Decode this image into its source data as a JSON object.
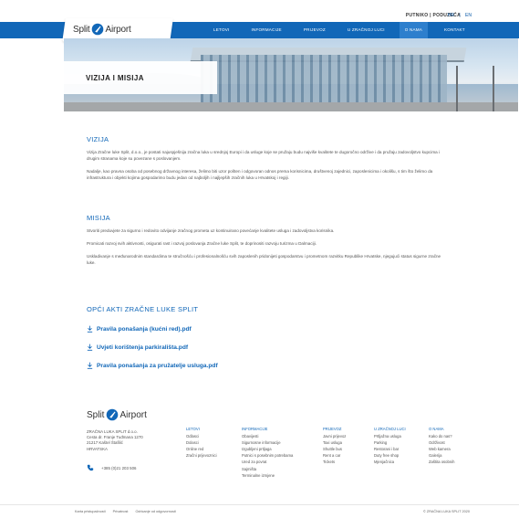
{
  "header": {
    "utility_label": "PUTNIKO | PODUZEĆA",
    "lang": [
      "HR",
      "EN"
    ],
    "logo_left": "Split",
    "logo_right": "Airport"
  },
  "nav": {
    "items": [
      {
        "label": "LETOVI",
        "active": false
      },
      {
        "label": "INFORMACIJE",
        "active": false
      },
      {
        "label": "PRIJEVOZ",
        "active": false
      },
      {
        "label": "U ZRAČNOJ LUCI",
        "active": false
      },
      {
        "label": "O NAMA",
        "active": true
      },
      {
        "label": "KONTAKT",
        "active": false
      }
    ]
  },
  "hero": {
    "title": "VIZIJA I MISIJA"
  },
  "vizija": {
    "heading": "VIZIJA",
    "p1": "Vizija Zračne luke Split, d.o.o., je postati najuspješnija zračna luka u srednjoj Europi i da usluge koje se pružaju budu najviše kvalitete te dugoročno održive i da pružaju zadovoljstvo kupcima i drugim stranama koje su povezane s poslovanjem.",
    "p2": "Nadalje, kao pravna osoba od posebnog državnog interesa, želimo biti uzor pošten i odgovoran odnos prema korisnicima, društvenoj zajednici, zaposlenicima i okolišu, s tim što želimo da infrastruktura i objekti kojima gospodarimo budu jedan od najboljih i najljepših zračnih luka u Hrvatskoj i regiji."
  },
  "misija": {
    "heading": "MISIJA",
    "p1": "Stvoriti preduvjete za sigurno i redovito odvijanje zračnog prometa uz kontinuirano povećanje kvalitete usluga i zadovoljstva korisnika.",
    "p2": "Promicati razvoj svih aktivnosti, osigurati rast i razvoj poslovanja Zračne luke Split, te doprinositi razvoju turizma u Dalmaciji.",
    "p3": "Uskladivanje s međunarodnim standardima te stručnošću i profesionalnošću svih zaposlenih pridonijeti gospodarstvu i prometnom razvitku Republike Hrvatske, njegujući status sigurne zračne luke."
  },
  "akti": {
    "heading": "OPĆI AKTI ZRAČNE LUKE SPLIT",
    "files": [
      "Pravila ponašanja (kućni red).pdf",
      "Uvjeti korištenja parkirališta.pdf",
      "Pravila ponašanja za pružatelje usluga.pdf"
    ]
  },
  "footer": {
    "logo_left": "Split",
    "logo_right": "Airport",
    "address": [
      "ZRAČNA LUKA SPLIT d.o.o.",
      "Cesta dr. Franje Tuđmana 1270",
      "21217 Kaštel Štafilić",
      "HRVATSKA"
    ],
    "phone": "+385 (0)21 203 506",
    "columns": [
      {
        "heading": "LETOVI",
        "items": [
          "Odlasci",
          "Dolasci",
          "Online red",
          "Zračni prijevoznici"
        ]
      },
      {
        "heading": "INFORMACIJE",
        "items": [
          "Obavijesti",
          "Sigurnosne informacije",
          "Izgubljeni prtljaga",
          "Putnici s posebnim potrebama",
          "Ured za povrat",
          "Sajmišta",
          "Terminalne izmjene"
        ]
      },
      {
        "heading": "PRIJEVOZ",
        "items": [
          "Javni prijevoz",
          "Taxi usluga",
          "Shuttle bus",
          "Rent a car",
          "Tickets"
        ]
      },
      {
        "heading": "U ZRAČNOJ LUCI",
        "items": [
          "Prtljažna usluga",
          "Parking",
          "Restorani i bar",
          "Duty free shop",
          "Mjenjačnica"
        ]
      },
      {
        "heading": "O NAMA",
        "items": [
          "Kako do nas?",
          "Održivost",
          "Web kamera",
          "Galerija",
          "Zaštita osobnih"
        ]
      }
    ],
    "bottom_links": [
      "Karta pristupačnosti",
      "Privatnost",
      "Odricanje od odgovornosti"
    ],
    "copyright": "© ZRAČNA LUKA SPLIT 2020"
  },
  "colors": {
    "brand_blue": "#1167b8",
    "nav_active": "#2d7fcd"
  }
}
